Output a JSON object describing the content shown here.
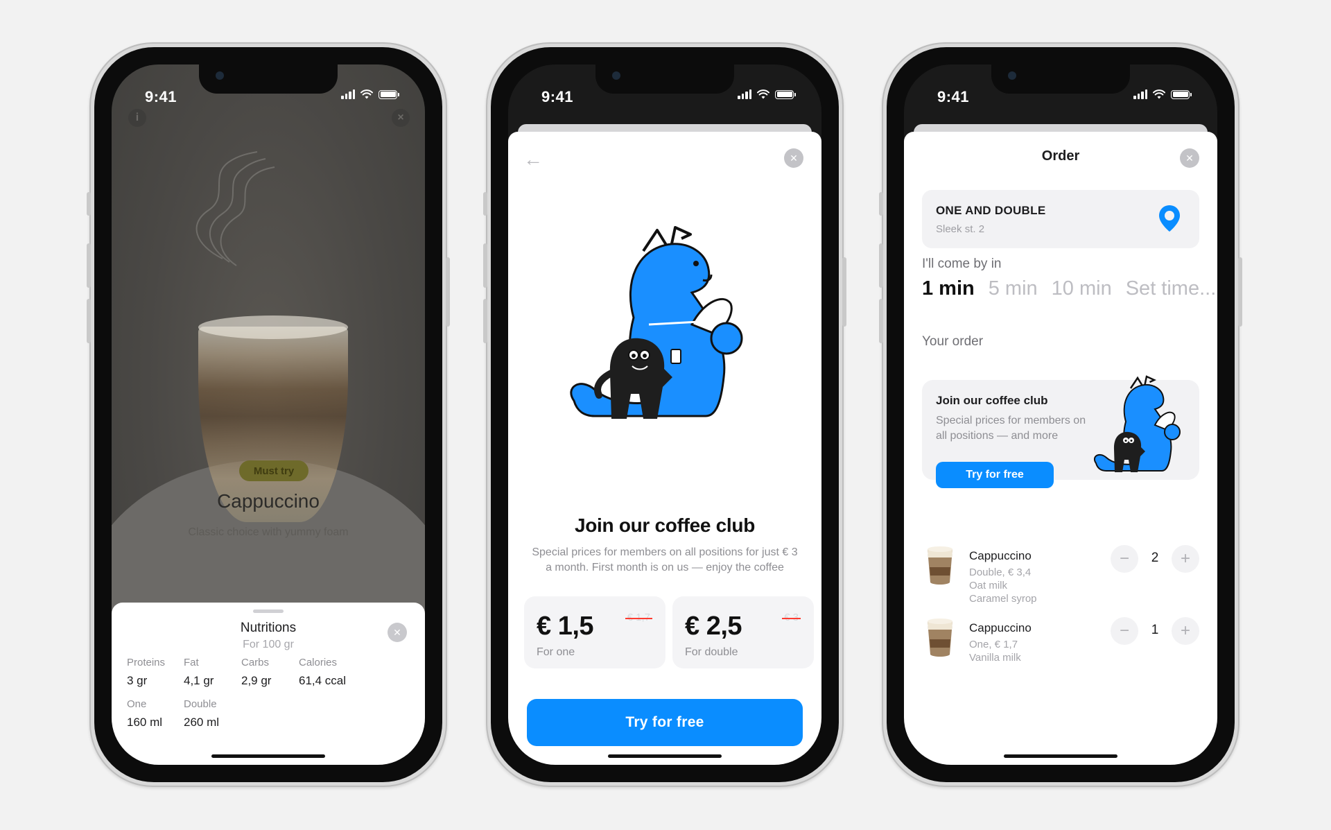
{
  "status": {
    "time": "9:41"
  },
  "screen1": {
    "badge": "Must try",
    "title": "Cappuccino",
    "subtitle": "Classic choice with yummy foam",
    "sheet": {
      "title": "Nutritions",
      "subtitle": "For 100 gr",
      "nutrients": [
        {
          "label": "Proteins",
          "value": "3 gr"
        },
        {
          "label": "Fat",
          "value": "4,1 gr"
        },
        {
          "label": "Carbs",
          "value": "2,9 gr"
        },
        {
          "label": "Calories",
          "value": "61,4 ccal"
        }
      ],
      "volumes": [
        {
          "label": "One",
          "value": "160 ml"
        },
        {
          "label": "Double",
          "value": "260 ml"
        }
      ]
    }
  },
  "screen2": {
    "title": "Join our coffee club",
    "description": "Special prices for members on all positions for just € 3 a month. First month is on us — enjoy the coffee",
    "prices": [
      {
        "price": "€ 1,5",
        "old": "€ 1,7",
        "label": "For one"
      },
      {
        "price": "€ 2,5",
        "old": "€ 3",
        "label": "For double"
      }
    ],
    "cta": "Try for free"
  },
  "screen3": {
    "header": "Order",
    "location": {
      "name": "ONE AND DOUBLE",
      "address": "Sleek st. 2"
    },
    "come_label": "I'll come by in",
    "times": [
      "1 min",
      "5 min",
      "10 min",
      "Set time..."
    ],
    "selected_time": "1 min",
    "your_order": "Your order",
    "club": {
      "title": "Join our coffee club",
      "description": "Special prices for members on all positions — and more",
      "cta": "Try for free"
    },
    "items": [
      {
        "name": "Cappuccino",
        "details": [
          "Double, € 3,4",
          "Oat milk",
          "Caramel syrop"
        ],
        "qty": "2"
      },
      {
        "name": "Cappuccino",
        "details": [
          "One, € 1,7",
          "Vanilla milk"
        ],
        "qty": "1"
      }
    ]
  },
  "colors": {
    "accent": "#0a8dff",
    "mascot": "#1a8fff",
    "ink": "#1c1c1e"
  }
}
